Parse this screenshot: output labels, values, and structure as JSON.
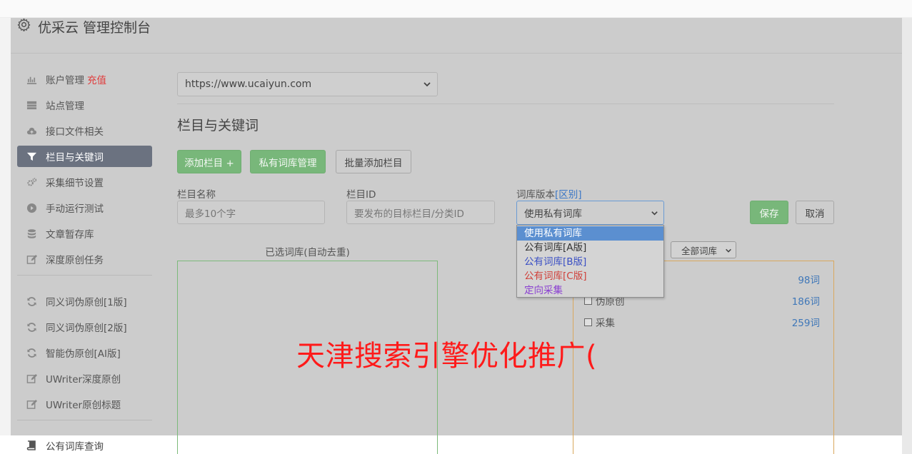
{
  "app": {
    "title": "优采云 管理控制台"
  },
  "sidebar": {
    "items": [
      {
        "label": "账户管理",
        "extra": "充值",
        "icon": "bar-chart-icon"
      },
      {
        "label": "站点管理",
        "icon": "server-icon"
      },
      {
        "label": "接口文件相关",
        "icon": "cloud-upload-icon"
      },
      {
        "label": "栏目与关键词",
        "icon": "filter-icon",
        "active": true
      },
      {
        "label": "采集细节设置",
        "icon": "cogs-icon"
      },
      {
        "label": "手动运行测试",
        "icon": "play-circle-icon"
      },
      {
        "label": "文章暂存库",
        "icon": "database-icon"
      },
      {
        "label": "深度原创任务",
        "icon": "edit-icon"
      },
      {
        "label": "同义词伪原创[1版]",
        "icon": "refresh-icon"
      },
      {
        "label": "同义词伪原创[2版]",
        "icon": "refresh-icon"
      },
      {
        "label": "智能伪原创[AI版]",
        "icon": "refresh-icon"
      },
      {
        "label": "UWriter深度原创",
        "icon": "edit-icon"
      },
      {
        "label": "UWriter原创标题",
        "icon": "edit-icon"
      },
      {
        "label": "公有词库查询",
        "icon": "book-icon"
      }
    ]
  },
  "site_select": {
    "value": "https://www.ucaiyun.com"
  },
  "section": {
    "title": "栏目与关键词"
  },
  "toolbar": {
    "add_column": "添加栏目 +",
    "private_library": "私有词库管理",
    "batch_add": "批量添加栏目"
  },
  "form": {
    "column_name": {
      "label": "栏目名称",
      "placeholder": "最多10个字"
    },
    "column_id": {
      "label": "栏目ID",
      "placeholder": "要发布的目标栏目/分类ID"
    },
    "library_version": {
      "label": "词库版本",
      "link": "[区别]",
      "value": "使用私有词库",
      "options": [
        {
          "label": "使用私有词库",
          "color": "#ffffff"
        },
        {
          "label": "公有词库[A版]",
          "color": "#333333"
        },
        {
          "label": "公有词库[B版]",
          "color": "#3a4fc4"
        },
        {
          "label": "公有词库[C版]",
          "color": "#d0403a"
        },
        {
          "label": "定向采集",
          "color": "#8a3fd1"
        }
      ]
    },
    "save": "保存",
    "cancel": "取消"
  },
  "selected_panel": {
    "title": "已选词库(自动去重)"
  },
  "library_panel": {
    "filter": "全部词库",
    "rows": [
      {
        "name": "",
        "count": "98词"
      },
      {
        "name": "伪原创",
        "count": "186词"
      },
      {
        "name": "采集",
        "count": "259词"
      }
    ]
  },
  "watermark": "天津搜索引擎优化推广(",
  "colors": {
    "active_nav": "#6b7280",
    "green_button": "#78b77a",
    "recharge": "#e03b3b",
    "link": "#3b77c6"
  }
}
